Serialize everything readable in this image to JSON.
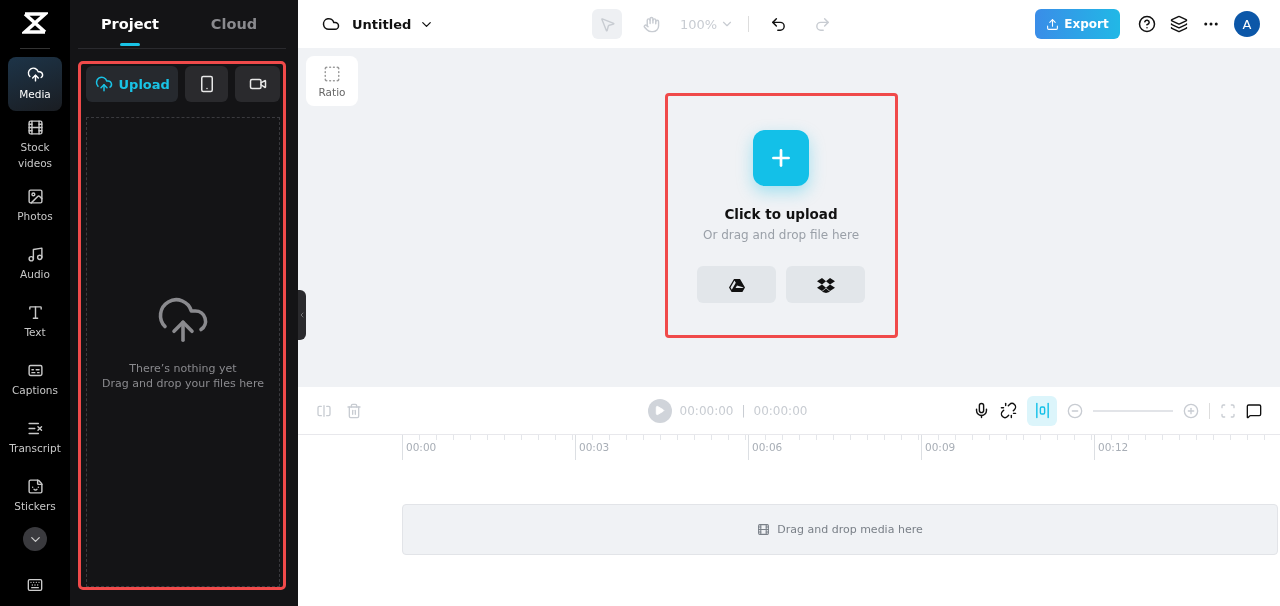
{
  "sidebar": {
    "items": [
      {
        "kind": "media",
        "label": "Media",
        "selected": true
      },
      {
        "kind": "stock",
        "label": "Stock videos",
        "selected": false
      },
      {
        "kind": "photos",
        "label": "Photos",
        "selected": false
      },
      {
        "kind": "audio",
        "label": "Audio",
        "selected": false
      },
      {
        "kind": "text",
        "label": "Text",
        "selected": false
      },
      {
        "kind": "captions",
        "label": "Captions",
        "selected": false
      },
      {
        "kind": "transcript",
        "label": "Transcript",
        "selected": false
      },
      {
        "kind": "stickers",
        "label": "Stickers",
        "selected": false
      }
    ]
  },
  "panel": {
    "tabs": [
      {
        "label": "Project",
        "selected": true
      },
      {
        "label": "Cloud",
        "selected": false
      }
    ],
    "sources": [
      {
        "kind": "upload",
        "label": "Upload",
        "selected": true
      },
      {
        "kind": "phone",
        "selected": false
      },
      {
        "kind": "record",
        "selected": false
      }
    ],
    "empty_title": "There’s nothing yet",
    "empty_hint": "Drag and drop your files here"
  },
  "topbar": {
    "title": "Untitled",
    "zoom": "100%",
    "export": "Export",
    "avatar": "A"
  },
  "canvas": {
    "ratio": "Ratio",
    "upload_title": "Click to upload",
    "upload_hint": "Or drag and drop file here"
  },
  "timeline": {
    "current_time": "00:00:00",
    "separator": "|",
    "duration": "00:00:00",
    "snap_on": true,
    "ticks": [
      "00:00",
      "00:03",
      "00:06",
      "00:09",
      "00:12"
    ],
    "drop_hint": "Drag and drop media here"
  }
}
